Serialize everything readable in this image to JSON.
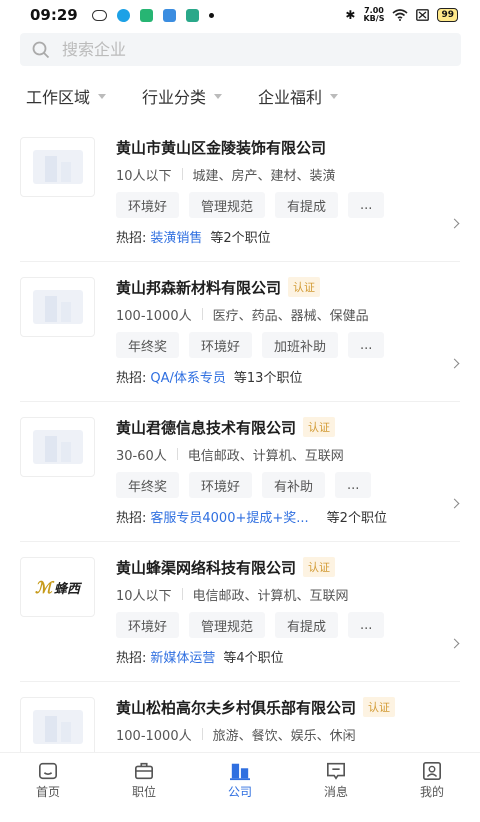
{
  "status_bar": {
    "time": "09:29",
    "net_speed_value": "7.00",
    "net_speed_unit": "KB/S",
    "battery": "99"
  },
  "search": {
    "placeholder": "搜索企业"
  },
  "filters": [
    {
      "label": "工作区域"
    },
    {
      "label": "行业分类"
    },
    {
      "label": "企业福利"
    }
  ],
  "companies": [
    {
      "name": "黄山市黄山区金陵装饰有限公司",
      "badge": "",
      "size": "10人以下",
      "industry": "城建、房产、建材、装潢",
      "tags": [
        "环境好",
        "管理规范",
        "有提成",
        "..."
      ],
      "hot_prefix": "热招:",
      "hot_job": "装潢销售",
      "hot_suffix": "等2个职位",
      "logo": "placeholder"
    },
    {
      "name": "黄山邦森新材料有限公司",
      "badge": "认证",
      "size": "100-1000人",
      "industry": "医疗、药品、器械、保健品",
      "tags": [
        "年终奖",
        "环境好",
        "加班补助",
        "..."
      ],
      "hot_prefix": "热招:",
      "hot_job": "QA/体系专员",
      "hot_suffix": "等13个职位",
      "logo": "placeholder"
    },
    {
      "name": "黄山君德信息技术有限公司",
      "badge": "认证",
      "size": "30-60人",
      "industry": "电信邮政、计算机、互联网",
      "tags": [
        "年终奖",
        "环境好",
        "有补助",
        "..."
      ],
      "hot_prefix": "热招:",
      "hot_job": "客服专员4000+提成+奖...",
      "hot_suffix": "等2个职位",
      "logo": "placeholder"
    },
    {
      "name": "黄山蜂渠网络科技有限公司",
      "badge": "认证",
      "size": "10人以下",
      "industry": "电信邮政、计算机、互联网",
      "tags": [
        "环境好",
        "管理规范",
        "有提成",
        "..."
      ],
      "hot_prefix": "热招:",
      "hot_job": "新媒体运营",
      "hot_suffix": "等4个职位",
      "logo": "brand",
      "logo_text": "蜂西"
    },
    {
      "name": "黄山松柏高尔夫乡村俱乐部有限公司",
      "badge": "认证",
      "size": "100-1000人",
      "industry": "旅游、餐饮、娱乐、休闲",
      "tags": [],
      "hot_prefix": "",
      "hot_job": "",
      "hot_suffix": "",
      "logo": "placeholder"
    }
  ],
  "tabbar": [
    {
      "label": "首页",
      "icon": "home-icon",
      "active": false
    },
    {
      "label": "职位",
      "icon": "briefcase-icon",
      "active": false
    },
    {
      "label": "公司",
      "icon": "building-icon",
      "active": true
    },
    {
      "label": "消息",
      "icon": "message-icon",
      "active": false
    },
    {
      "label": "我的",
      "icon": "profile-icon",
      "active": false
    }
  ],
  "colors": {
    "accent": "#2f6fe0",
    "badge_text": "#d29b35",
    "badge_bg": "#fdf3e2",
    "tag_bg": "#f5f6f8"
  }
}
